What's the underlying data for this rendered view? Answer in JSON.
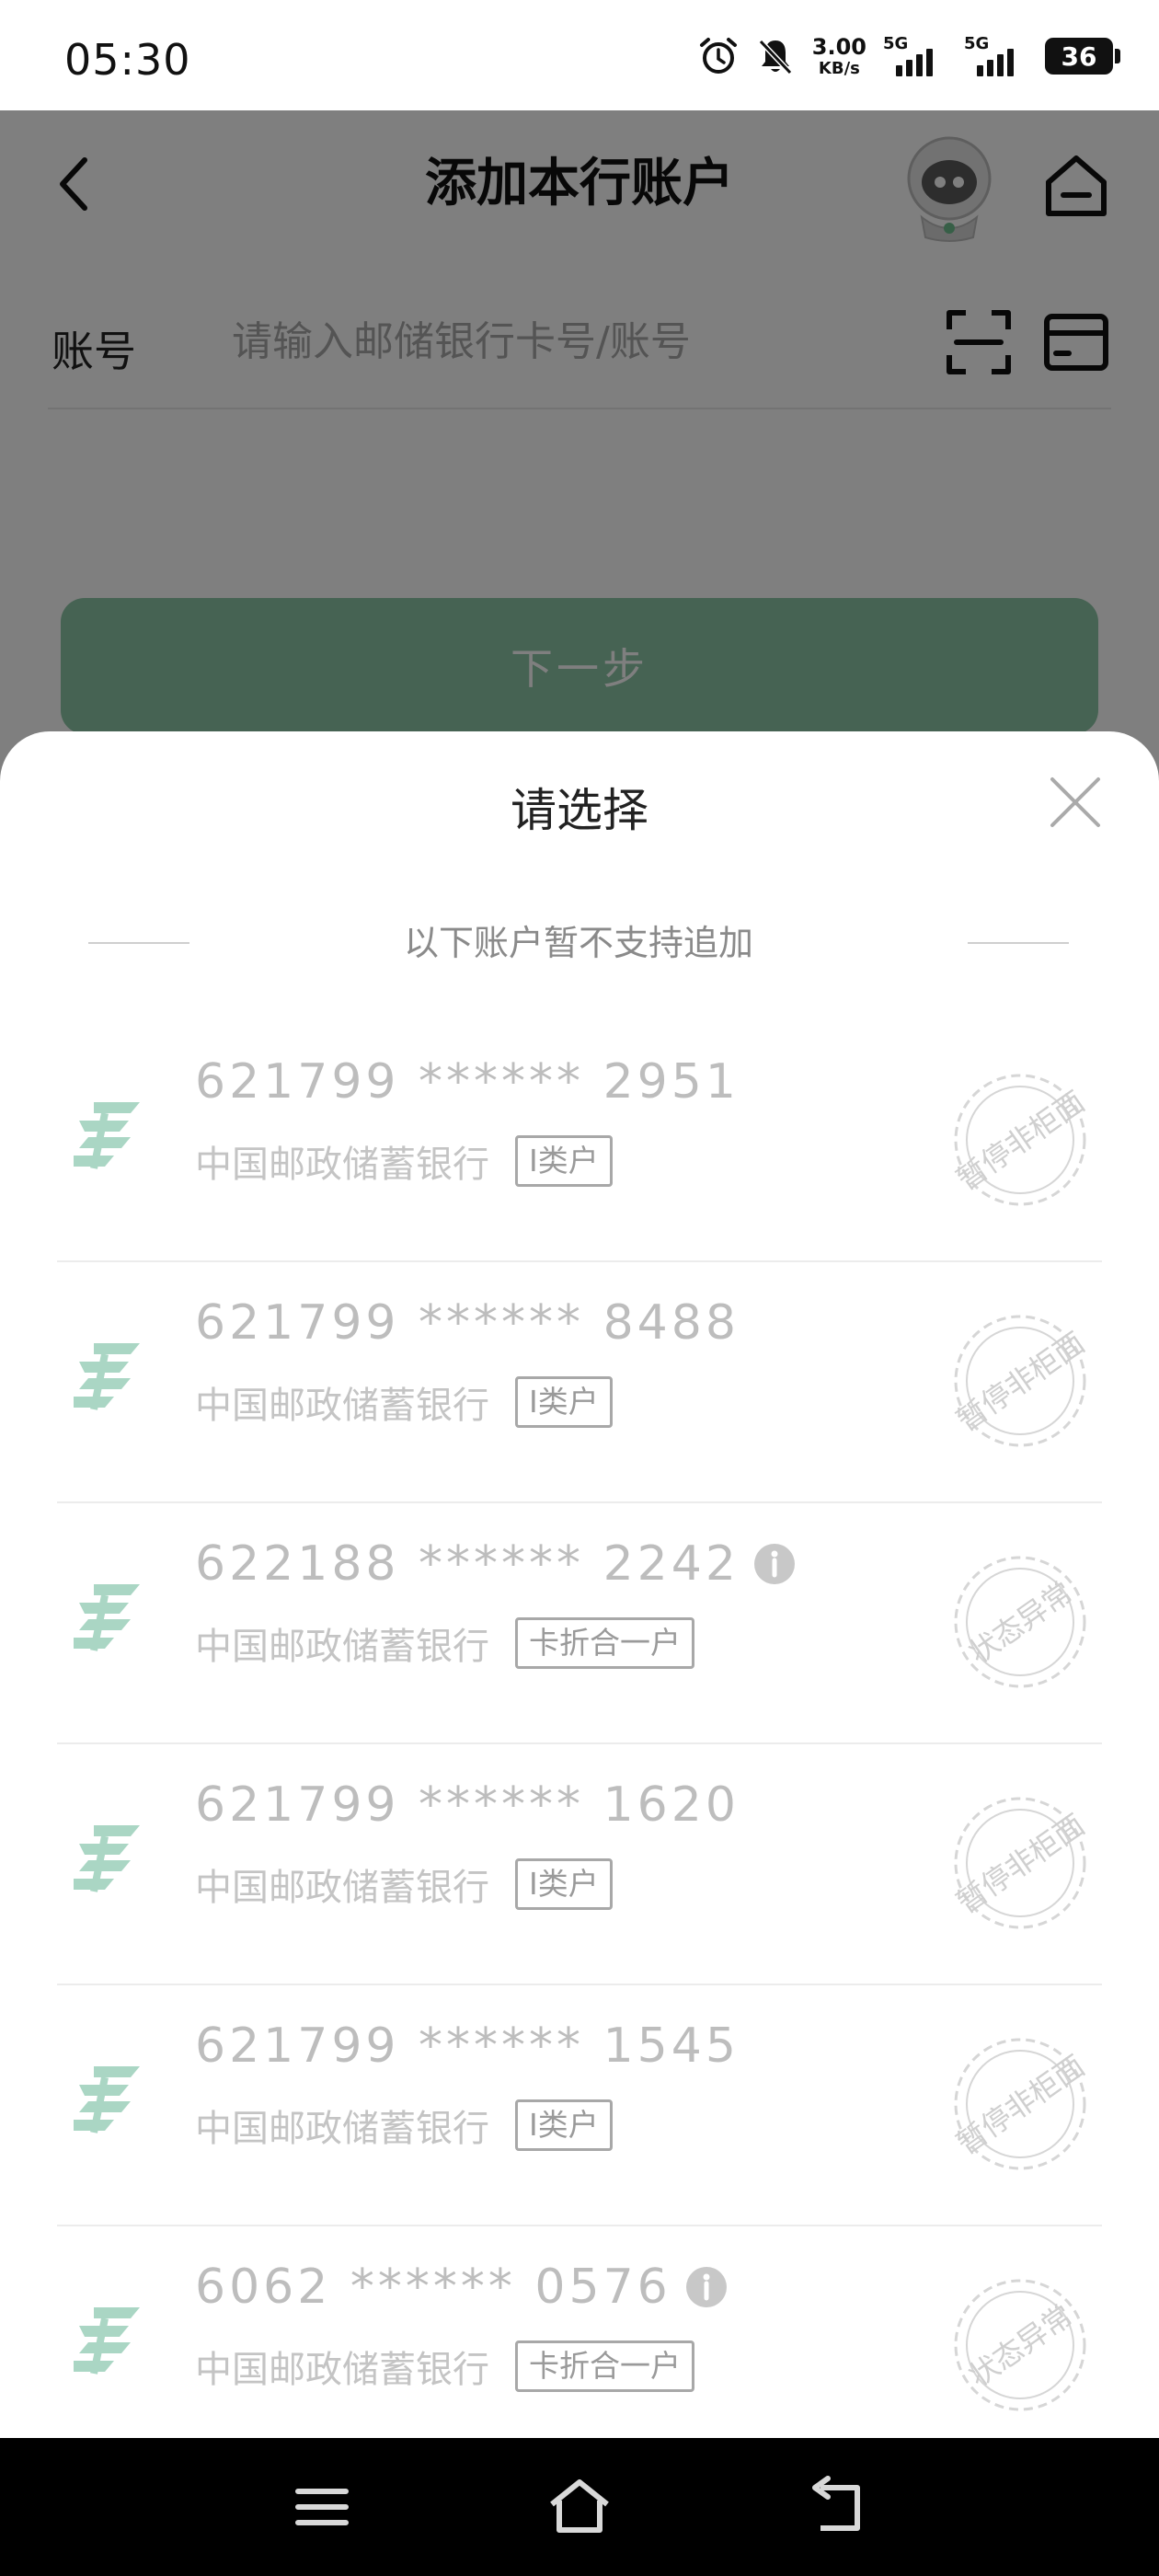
{
  "status_bar": {
    "time": "05:30",
    "net_speed_value": "3.00",
    "net_speed_unit": "KB/s",
    "sim1_label": "5G",
    "sim2_label": "5G",
    "battery": "36",
    "icons": [
      "alarm-icon",
      "mute-icon",
      "signal-icon",
      "signal-icon",
      "battery-icon"
    ]
  },
  "page": {
    "title": "添加本行账户",
    "account_label": "账号",
    "account_placeholder": "请输入邮储银行卡号/账号",
    "account_value": "",
    "next_button": "下一步",
    "icons": [
      "back-icon",
      "mascot-icon",
      "home-icon",
      "scan-icon",
      "card-icon"
    ]
  },
  "sheet": {
    "title": "请选择",
    "notice": "以下账户暂不支持追加",
    "accounts": [
      {
        "number": "621799 ****** 2951",
        "bank": "中国邮政储蓄银行",
        "tag": "I类户",
        "stamp": "暂停非柜面",
        "info": false
      },
      {
        "number": "621799 ****** 8488",
        "bank": "中国邮政储蓄银行",
        "tag": "I类户",
        "stamp": "暂停非柜面",
        "info": false
      },
      {
        "number": "622188 ****** 2242",
        "bank": "中国邮政储蓄银行",
        "tag": "卡折合一户",
        "stamp": "状态异常",
        "info": true
      },
      {
        "number": "621799 ****** 1620",
        "bank": "中国邮政储蓄银行",
        "tag": "I类户",
        "stamp": "暂停非柜面",
        "info": false
      },
      {
        "number": "621799 ****** 1545",
        "bank": "中国邮政储蓄银行",
        "tag": "I类户",
        "stamp": "暂停非柜面",
        "info": false
      },
      {
        "number": "6062 ****** 0576",
        "bank": "中国邮政储蓄银行",
        "tag": "卡折合一户",
        "stamp": "状态异常",
        "info": true
      }
    ]
  },
  "system_nav": {
    "icons": [
      "menu-icon",
      "home-icon",
      "back-icon"
    ]
  },
  "colors": {
    "brand_green": "#8dc6a6",
    "logo_green": "#aad6c4",
    "overlay": "#000000"
  }
}
